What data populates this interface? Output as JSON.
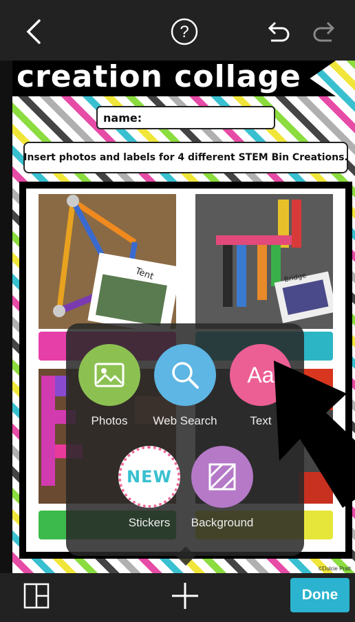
{
  "toolbar": {
    "back_icon": "chevron-left-icon",
    "help_icon": "help-circle-icon",
    "undo_icon": "undo-icon",
    "redo_icon": "redo-icon"
  },
  "collage": {
    "title": "creation collage",
    "name_label": "name:",
    "instruction": "Insert photos and labels for 4 different STEM Bin Creations.",
    "photo_captions": [
      "Tent",
      "Bridge"
    ],
    "label_colors": [
      "#e63fa8",
      "#2cb5c4",
      "#3dba4c",
      "#e6e63a"
    ],
    "credit": "©Dulcie Pratt"
  },
  "add_menu": {
    "items": [
      {
        "label": "Photos",
        "icon": "image-icon",
        "color": "#8cc152"
      },
      {
        "label": "Web Search",
        "icon": "search-icon",
        "color": "#5db6e3"
      },
      {
        "label": "Text",
        "icon": "text-icon",
        "icon_text": "Aa",
        "color": "#ec5f94"
      },
      {
        "label": "Stickers",
        "icon": "stickers-icon",
        "icon_text": "NEW",
        "color": "#ffffff"
      },
      {
        "label": "Background",
        "icon": "background-icon",
        "color": "#b579c8"
      }
    ]
  },
  "bottombar": {
    "layout_icon": "layout-grid-icon",
    "add_icon": "plus-icon",
    "done_label": "Done"
  },
  "colors": {
    "accent": "#2bb3cf",
    "bar": "#222222"
  }
}
